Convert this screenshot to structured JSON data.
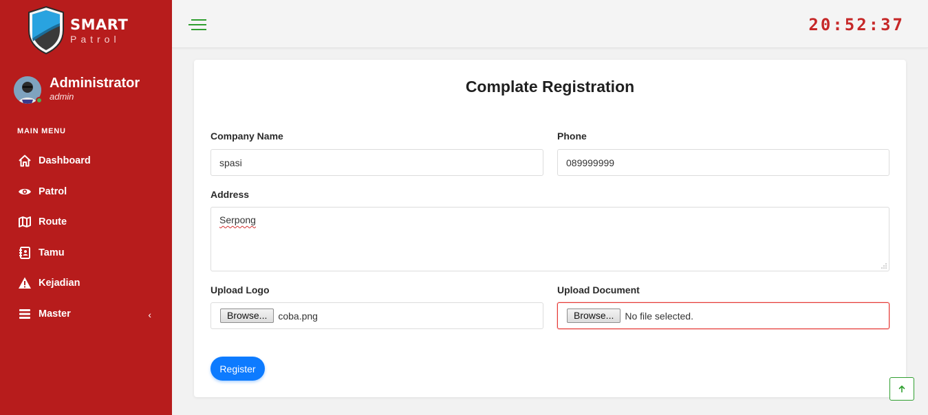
{
  "brand": {
    "name": "SMART",
    "tagline": "Patrol"
  },
  "user": {
    "name": "Administrator",
    "role": "admin"
  },
  "sidebar": {
    "menu_title": "MAIN MENU",
    "items": [
      {
        "label": "Dashboard",
        "icon": "home-icon"
      },
      {
        "label": "Patrol",
        "icon": "eye-icon"
      },
      {
        "label": "Route",
        "icon": "map-icon"
      },
      {
        "label": "Tamu",
        "icon": "guestbook-icon"
      },
      {
        "label": "Kejadian",
        "icon": "warning-icon"
      },
      {
        "label": "Master",
        "icon": "bars-icon",
        "has_submenu": true
      }
    ]
  },
  "topbar": {
    "clock": "20:52:37"
  },
  "form": {
    "title": "Complate Registration",
    "company_name": {
      "label": "Company Name",
      "value": "spasi"
    },
    "phone": {
      "label": "Phone",
      "value": "089999999"
    },
    "address": {
      "label": "Address",
      "value": "Serpong"
    },
    "upload_logo": {
      "label": "Upload Logo",
      "button": "Browse...",
      "file": "coba.png"
    },
    "upload_document": {
      "label": "Upload Document",
      "button": "Browse...",
      "file": "No file selected."
    },
    "submit_label": "Register"
  },
  "colors": {
    "sidebar": "#b71c1c",
    "accent_green": "#2e9e2e",
    "clock": "#c62828",
    "primary_button": "#0d7bff",
    "error_border": "#e53935"
  }
}
